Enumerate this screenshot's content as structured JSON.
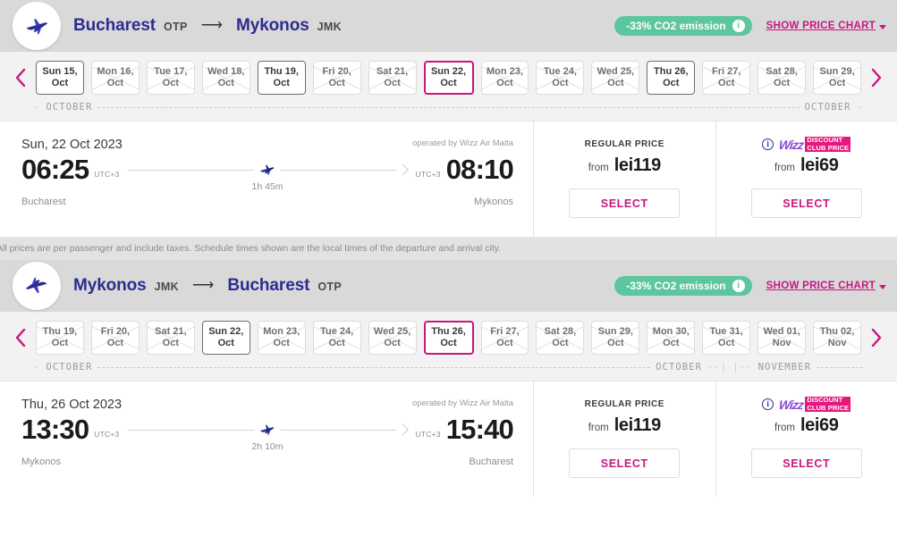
{
  "flights": [
    {
      "header": {
        "origin_city": "Bucharest",
        "origin_code": "OTP",
        "arrow": "⟶",
        "dest_city": "Mykonos",
        "dest_code": "JMK",
        "co2_label": "-33% CO2 emission",
        "co2_info_icon": "info-icon",
        "co2_color": "#5cc79e",
        "show_price_chart": "SHOW PRICE CHART",
        "plane_icon": "plane-depart-icon"
      },
      "date_strip": {
        "prev_icon": "chevron-left-icon",
        "next_icon": "chevron-right-icon",
        "cells": [
          {
            "day": "Sun 15,",
            "month": "Oct",
            "state": "available"
          },
          {
            "day": "Mon 16,",
            "month": "Oct",
            "state": "unavailable"
          },
          {
            "day": "Tue 17,",
            "month": "Oct",
            "state": "unavailable"
          },
          {
            "day": "Wed 18,",
            "month": "Oct",
            "state": "unavailable"
          },
          {
            "day": "Thu 19,",
            "month": "Oct",
            "state": "available"
          },
          {
            "day": "Fri 20,",
            "month": "Oct",
            "state": "unavailable"
          },
          {
            "day": "Sat 21,",
            "month": "Oct",
            "state": "unavailable"
          },
          {
            "day": "Sun 22,",
            "month": "Oct",
            "state": "selected"
          },
          {
            "day": "Mon 23,",
            "month": "Oct",
            "state": "unavailable"
          },
          {
            "day": "Tue 24,",
            "month": "Oct",
            "state": "unavailable"
          },
          {
            "day": "Wed 25,",
            "month": "Oct",
            "state": "unavailable"
          },
          {
            "day": "Thu 26,",
            "month": "Oct",
            "state": "available"
          },
          {
            "day": "Fri 27,",
            "month": "Oct",
            "state": "unavailable"
          },
          {
            "day": "Sat 28,",
            "month": "Oct",
            "state": "unavailable"
          },
          {
            "day": "Sun 29,",
            "month": "Oct",
            "state": "unavailable"
          }
        ],
        "legend_left": "OCTOBER",
        "legend_right": "OCTOBER",
        "legend_center": ""
      },
      "result": {
        "date": "Sun, 22 Oct 2023",
        "operated_by": "operated by Wizz Air Malta",
        "depart_time": "06:25",
        "depart_utc": "UTC+3",
        "depart_city": "Bucharest",
        "arrive_time": "08:10",
        "arrive_utc": "UTC+3",
        "arrive_city": "Mykonos",
        "duration": "1h 45m",
        "plane_icon": "plane-icon"
      },
      "prices": [
        {
          "label": "REGULAR PRICE",
          "from": "from",
          "value": "lei119",
          "select": "SELECT",
          "kind": "regular"
        },
        {
          "label": "",
          "from": "from",
          "value": "lei69",
          "select": "SELECT",
          "kind": "wdc",
          "wdc_wizz": "Wizz",
          "wdc_line1": "DISCOUNT",
          "wdc_line2": "CLUB PRICE",
          "info_icon": "info-icon"
        }
      ],
      "disclaimer": "All prices are per passenger and include taxes. Schedule times shown are the local times of the departure and arrival city."
    },
    {
      "header": {
        "origin_city": "Mykonos",
        "origin_code": "JMK",
        "arrow": "⟶",
        "dest_city": "Bucharest",
        "dest_code": "OTP",
        "co2_label": "-33% CO2 emission",
        "co2_info_icon": "info-icon",
        "co2_color": "#5cc79e",
        "show_price_chart": "SHOW PRICE CHART",
        "plane_icon": "plane-return-icon"
      },
      "date_strip": {
        "prev_icon": "chevron-left-icon",
        "next_icon": "chevron-right-icon",
        "cells": [
          {
            "day": "Thu 19,",
            "month": "Oct",
            "state": "unavailable"
          },
          {
            "day": "Fri 20,",
            "month": "Oct",
            "state": "unavailable"
          },
          {
            "day": "Sat 21,",
            "month": "Oct",
            "state": "unavailable"
          },
          {
            "day": "Sun 22,",
            "month": "Oct",
            "state": "available"
          },
          {
            "day": "Mon 23,",
            "month": "Oct",
            "state": "unavailable"
          },
          {
            "day": "Tue 24,",
            "month": "Oct",
            "state": "unavailable"
          },
          {
            "day": "Wed 25,",
            "month": "Oct",
            "state": "unavailable"
          },
          {
            "day": "Thu 26,",
            "month": "Oct",
            "state": "selected"
          },
          {
            "day": "Fri 27,",
            "month": "Oct",
            "state": "unavailable"
          },
          {
            "day": "Sat 28,",
            "month": "Oct",
            "state": "unavailable"
          },
          {
            "day": "Sun 29,",
            "month": "Oct",
            "state": "unavailable"
          },
          {
            "day": "Mon 30,",
            "month": "Oct",
            "state": "unavailable"
          },
          {
            "day": "Tue 31,",
            "month": "Oct",
            "state": "unavailable"
          },
          {
            "day": "Wed 01,",
            "month": "Nov",
            "state": "unavailable"
          },
          {
            "day": "Thu 02,",
            "month": "Nov",
            "state": "unavailable"
          }
        ],
        "legend_left": "OCTOBER",
        "legend_right": "OCTOBER",
        "legend_center": "NOVEMBER"
      },
      "result": {
        "date": "Thu, 26 Oct 2023",
        "operated_by": "operated by Wizz Air Malta",
        "depart_time": "13:30",
        "depart_utc": "UTC+3",
        "depart_city": "Mykonos",
        "arrive_time": "15:40",
        "arrive_utc": "UTC+3",
        "arrive_city": "Bucharest",
        "duration": "2h 10m",
        "plane_icon": "plane-icon"
      },
      "prices": [
        {
          "label": "REGULAR PRICE",
          "from": "from",
          "value": "lei119",
          "select": "SELECT",
          "kind": "regular"
        },
        {
          "label": "",
          "from": "from",
          "value": "lei69",
          "select": "SELECT",
          "kind": "wdc",
          "wdc_wizz": "Wizz",
          "wdc_line1": "DISCOUNT",
          "wdc_line2": "CLUB PRICE",
          "info_icon": "info-icon"
        }
      ],
      "disclaimer": ""
    }
  ]
}
